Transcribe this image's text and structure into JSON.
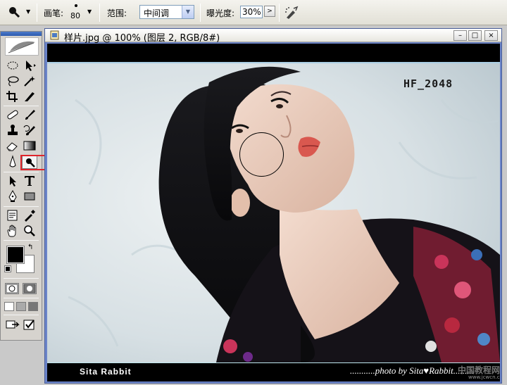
{
  "options_bar": {
    "brush_label": "画笔:",
    "brush_size": "80",
    "range_label": "范围:",
    "range_value": "中间调",
    "exposure_label": "曝光度:",
    "exposure_value": "30%",
    "exposure_button": ">"
  },
  "document": {
    "title": "样片.jpg @ 100% (图层 2, RGB/8#)",
    "minimize": "–",
    "maximize": "□",
    "close": "×"
  },
  "photo": {
    "watermark_top": "HF_2048",
    "caption_left": "Sita Rabbit",
    "caption_right": "...........photo by Sita♥Rabbit.........",
    "site_mark": "中国教程网",
    "site_url": "www.jcwcn.com"
  },
  "toolbox": {
    "swap_icon": "↰"
  },
  "colors": {
    "accent_title": "#2c5bb0",
    "highlight_red": "#e0242b",
    "window_frame": "#6b84c9"
  }
}
